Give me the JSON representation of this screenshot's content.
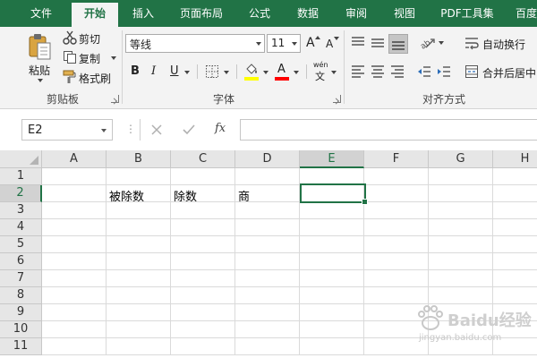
{
  "tabs": [
    {
      "label": "文件",
      "active": false
    },
    {
      "label": "开始",
      "active": true
    },
    {
      "label": "插入",
      "active": false
    },
    {
      "label": "页面布局",
      "active": false
    },
    {
      "label": "公式",
      "active": false
    },
    {
      "label": "数据",
      "active": false
    },
    {
      "label": "审阅",
      "active": false
    },
    {
      "label": "视图",
      "active": false
    },
    {
      "label": "PDF工具集",
      "active": false
    },
    {
      "label": "百度",
      "active": false
    }
  ],
  "clipboard": {
    "paste_label": "粘贴",
    "cut_label": "剪切",
    "copy_label": "复制",
    "format_painter_label": "格式刷",
    "group_label": "剪贴板"
  },
  "font": {
    "font_name": "等线",
    "font_size": "11",
    "bold": "B",
    "italic": "I",
    "underline": "U",
    "increase_size": "A",
    "decrease_size": "A",
    "font_color_letter": "A",
    "phonetic_top": "wén",
    "phonetic_bottom": "文",
    "group_label": "字体",
    "font_color": "#ff0000",
    "fill_color": "#ffff00"
  },
  "alignment": {
    "wrap_text_label": "自动换行",
    "merge_center_label": "合并后居中",
    "group_label": "对齐方式"
  },
  "formula_bar": {
    "name_box": "E2",
    "fx_label": "fx",
    "formula_value": ""
  },
  "sheet": {
    "columns": [
      "A",
      "B",
      "C",
      "D",
      "E",
      "F",
      "G",
      "H"
    ],
    "selected_column": "E",
    "rows": [
      "1",
      "2",
      "3",
      "4",
      "5",
      "6",
      "7",
      "8",
      "9",
      "10",
      "11"
    ],
    "selected_row": "2",
    "cells": {
      "B2": "被除数",
      "C2": "除数",
      "D2": "商"
    },
    "selected_cell": "E2"
  },
  "colors": {
    "accent": "#217346",
    "ribbon_bg": "#f3f3f3"
  },
  "watermark": {
    "brand": "Baidu经验",
    "url": "jingyan.baidu.com"
  }
}
